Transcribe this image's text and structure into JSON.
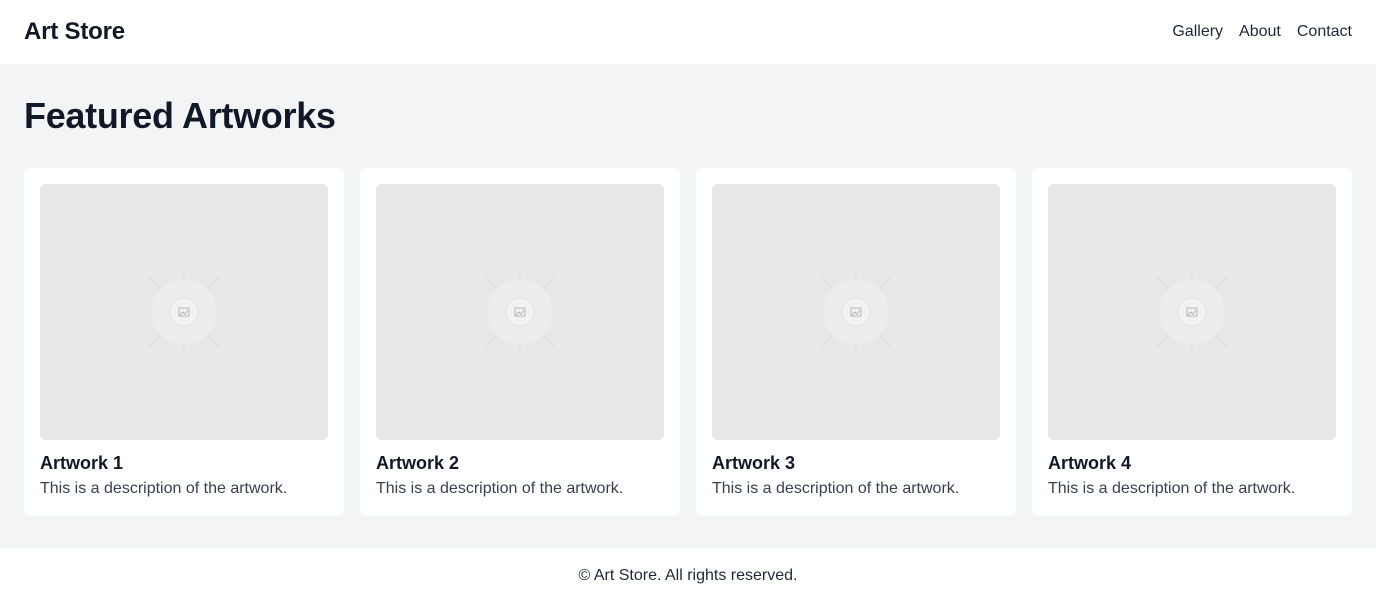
{
  "header": {
    "brand": "Art Store",
    "nav": [
      {
        "label": "Gallery"
      },
      {
        "label": "About"
      },
      {
        "label": "Contact"
      }
    ]
  },
  "main": {
    "title": "Featured Artworks",
    "artworks": [
      {
        "title": "Artwork 1",
        "description": "This is a description of the artwork.",
        "image_icon": "image-placeholder-icon"
      },
      {
        "title": "Artwork 2",
        "description": "This is a description of the artwork.",
        "image_icon": "image-placeholder-icon"
      },
      {
        "title": "Artwork 3",
        "description": "This is a description of the artwork.",
        "image_icon": "image-placeholder-icon"
      },
      {
        "title": "Artwork 4",
        "description": "This is a description of the artwork.",
        "image_icon": "image-placeholder-icon"
      }
    ]
  },
  "footer": {
    "text": "© Art Store. All rights reserved."
  },
  "colors": {
    "page_background": "#f3f4f6",
    "card_background": "#ffffff",
    "placeholder_background": "#e8e8e8",
    "text_primary": "#111827"
  }
}
